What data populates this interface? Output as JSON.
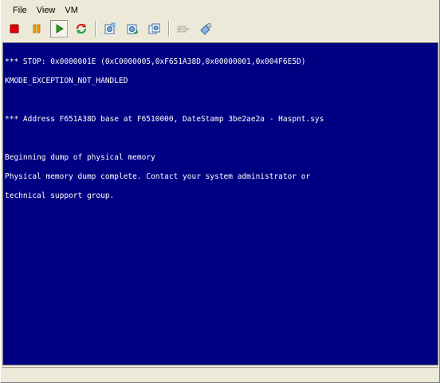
{
  "menu": {
    "items": [
      {
        "label": "File"
      },
      {
        "label": "View"
      },
      {
        "label": "VM"
      }
    ]
  },
  "toolbar": {
    "buttons": [
      {
        "icon": "stop-icon",
        "state": "normal"
      },
      {
        "icon": "pause-icon",
        "state": "normal"
      },
      {
        "icon": "play-icon",
        "state": "pressed"
      },
      {
        "icon": "reset-icon",
        "state": "normal"
      },
      {
        "icon": "snapshot-icon",
        "state": "normal"
      },
      {
        "icon": "revert-snapshot-icon",
        "state": "normal"
      },
      {
        "icon": "snapshot-manager-icon",
        "state": "normal"
      },
      {
        "icon": "usb-device-icon",
        "state": "disabled"
      },
      {
        "icon": "install-tools-icon",
        "state": "normal"
      }
    ],
    "colors": {
      "stop": "#e00000",
      "pause": "#f0a000",
      "play": "#20a020",
      "reset_red": "#d02020",
      "reset_green": "#20a040"
    }
  },
  "screen": {
    "background": "#000082",
    "foreground": "#ffffff",
    "lines": [
      "*** STOP: 0x0000001E (0xC0000005,0xF651A38D,0x00000001,0x004F6E5D)",
      "KMODE_EXCEPTION_NOT_HANDLED",
      "",
      "*** Address F651A38D base at F6510000, DateStamp 3be2ae2a - Haspnt.sys",
      "",
      "Beginning dump of physical memory",
      "Physical memory dump complete. Contact your system administrator or",
      "technical support group."
    ]
  }
}
